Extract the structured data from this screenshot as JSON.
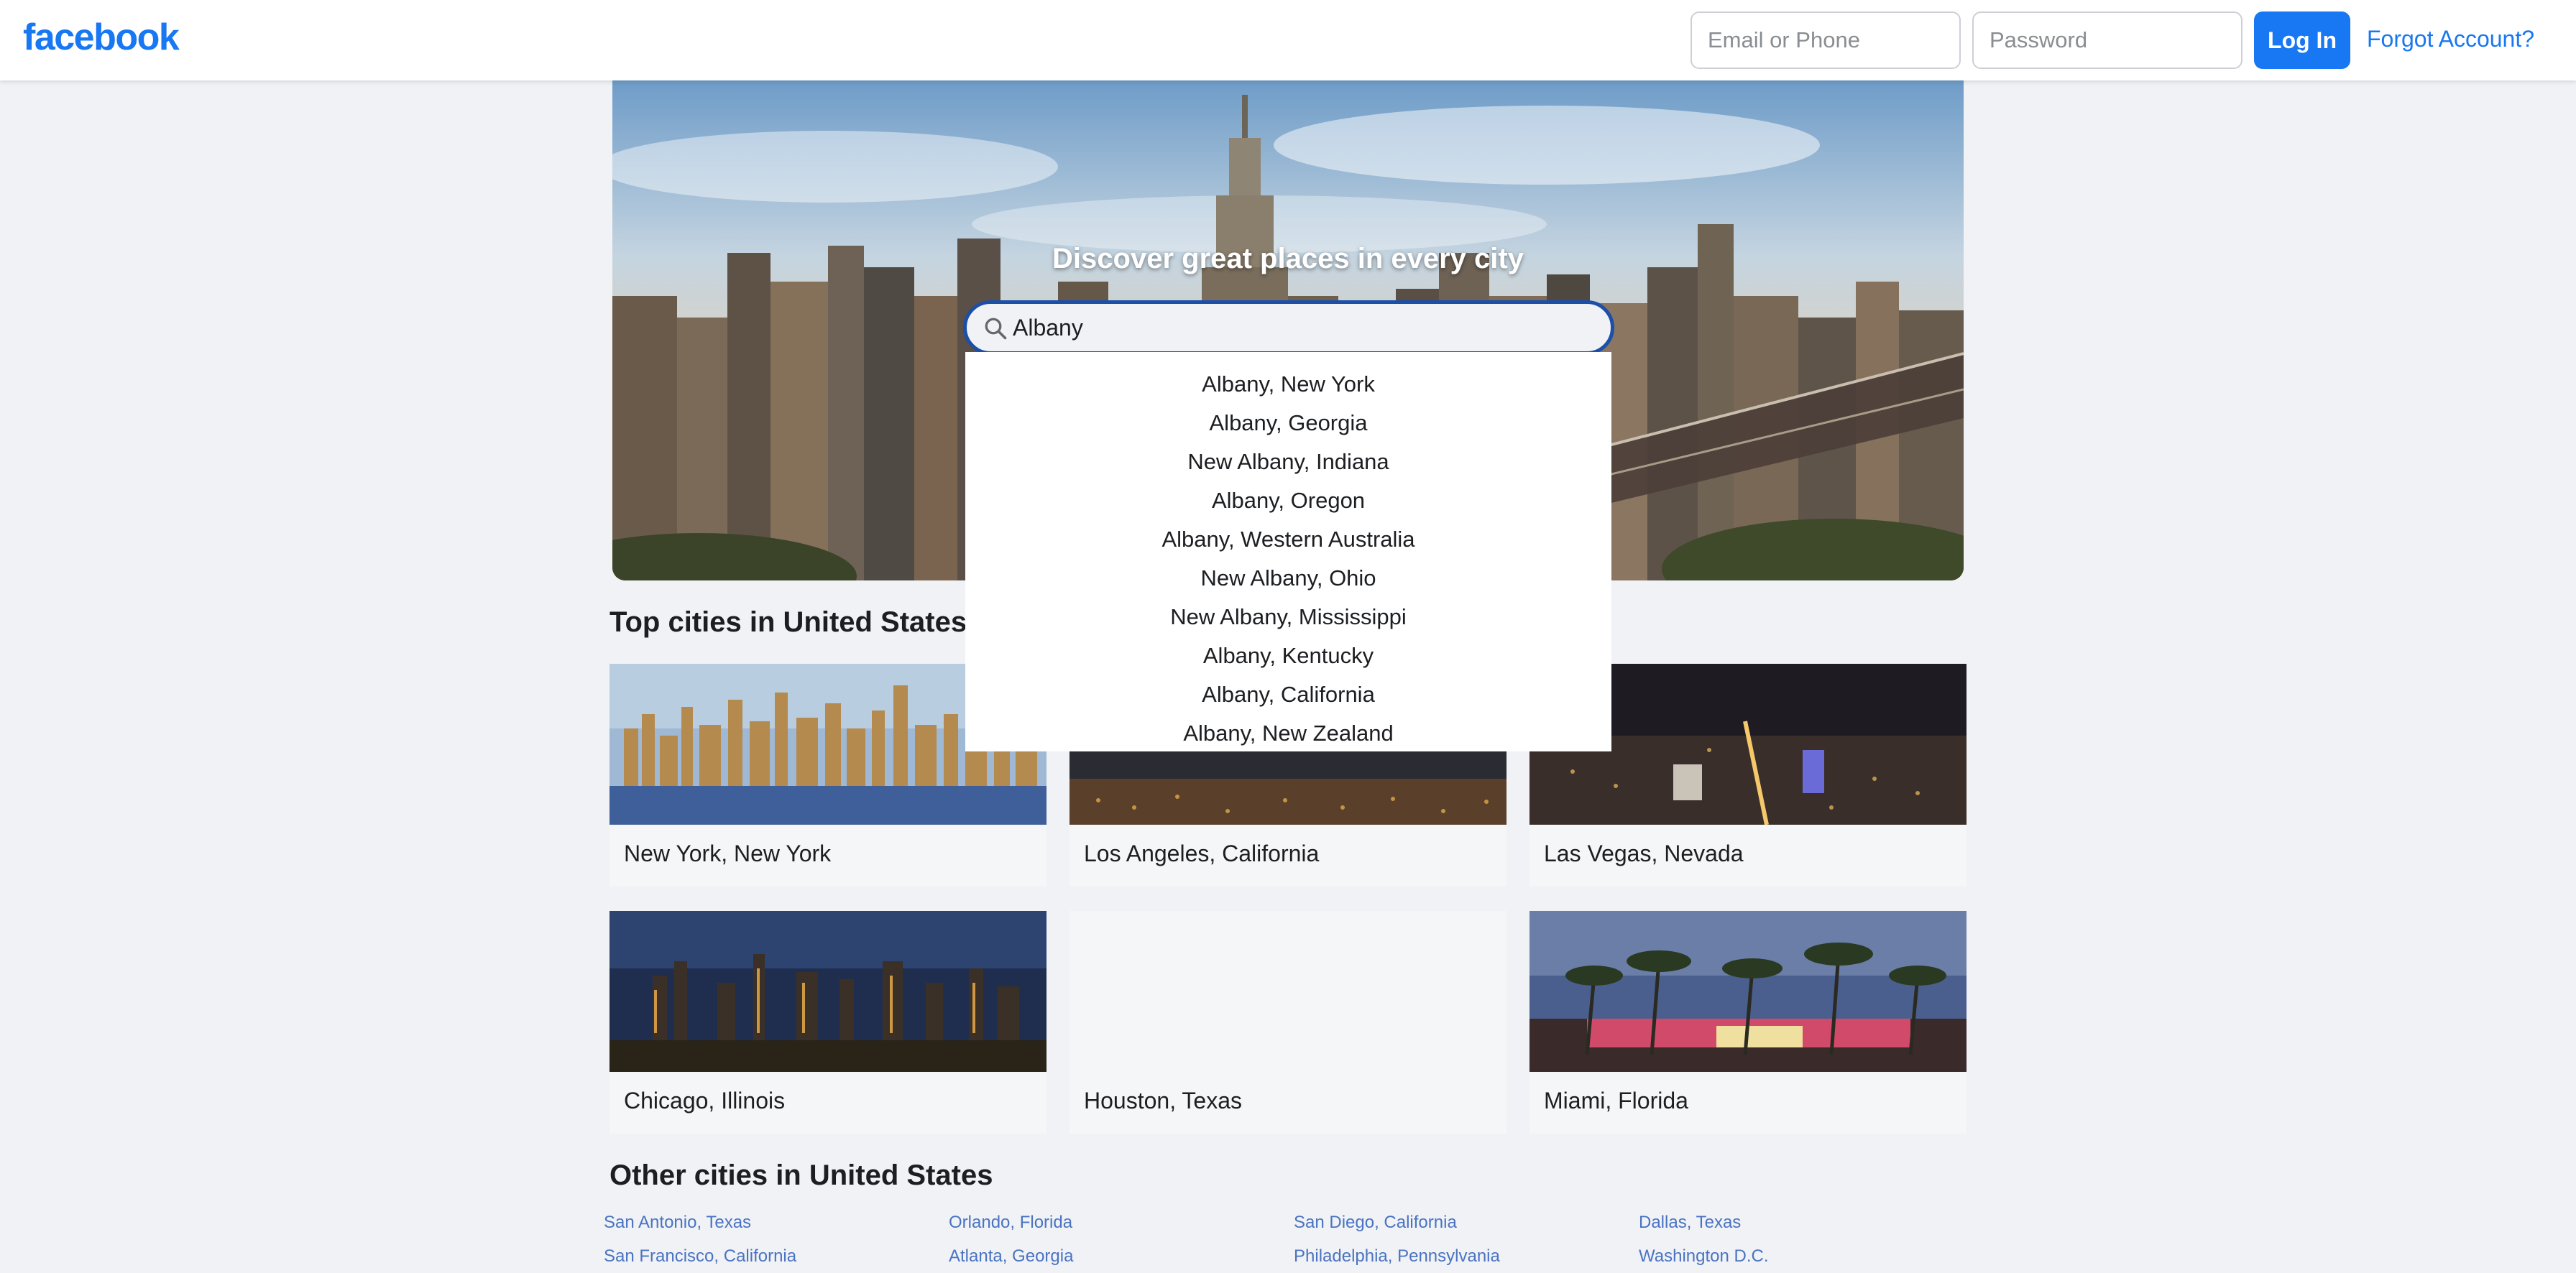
{
  "header": {
    "logo": "facebook",
    "email_placeholder": "Email or Phone",
    "password_placeholder": "Password",
    "login_label": "Log In",
    "forgot_label": "Forgot Account?"
  },
  "hero": {
    "title": "Discover great places in every city"
  },
  "search": {
    "value": "Albany",
    "suggestions": [
      "Albany, New York",
      "Albany, Georgia",
      "New Albany, Indiana",
      "Albany, Oregon",
      "Albany, Western Australia",
      "New Albany, Ohio",
      "New Albany, Mississippi",
      "Albany, Kentucky",
      "Albany, California",
      "Albany, New Zealand"
    ]
  },
  "top_cities": {
    "title": "Top cities in United States",
    "items": [
      "New York, New York",
      "Los Angeles, California",
      "Las Vegas, Nevada",
      "Chicago, Illinois",
      "Houston, Texas",
      "Miami, Florida"
    ]
  },
  "other_cities": {
    "title": "Other cities in United States",
    "items": [
      "San Antonio, Texas",
      "Orlando, Florida",
      "San Diego, California",
      "Dallas, Texas",
      "San Francisco, California",
      "Atlanta, Georgia",
      "Philadelphia, Pennsylvania",
      "Washington D.C."
    ]
  },
  "colors": {
    "brand": "#1877f2",
    "background": "#f0f2f5",
    "link": "#4a73c2",
    "search_border": "#1c4fa8"
  }
}
